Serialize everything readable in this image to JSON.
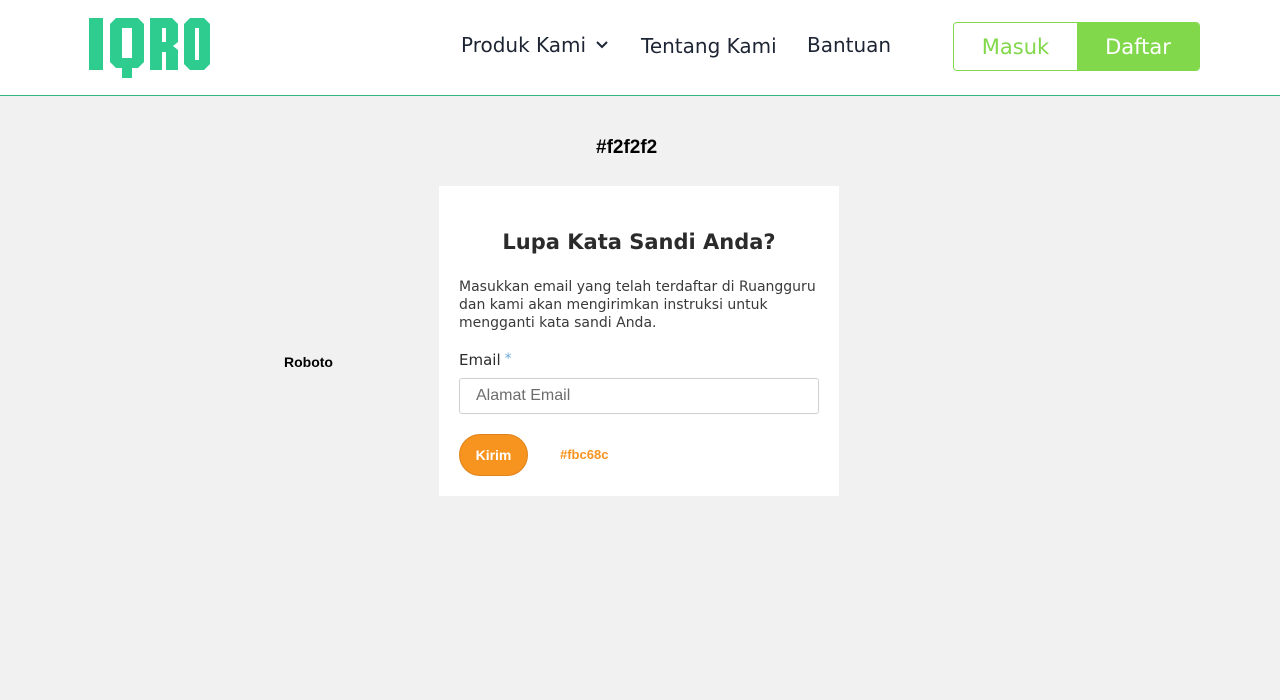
{
  "header": {
    "logo_text": "IQRO",
    "logo_color": "#2ecc8f",
    "nav": {
      "produk": "Produk Kami",
      "tentang": "Tentang Kami",
      "bantuan": "Bantuan"
    },
    "masuk_label": "Masuk",
    "daftar_label": "Daftar",
    "accent": "#82d84b"
  },
  "annotations": {
    "background_color": "#f2f2f2",
    "font_note": "Roboto",
    "button_color": "#fbc68c"
  },
  "form": {
    "title": "Lupa Kata Sandi Anda?",
    "description": "Masukkan email yang telah terdaftar di Ruangguru dan kami akan mengirimkan instruksi untuk mengganti kata sandi Anda.",
    "email_label": "Email",
    "required_marker": "*",
    "email_placeholder": "Alamat Email",
    "email_value": "",
    "submit_label": "Kirim"
  }
}
